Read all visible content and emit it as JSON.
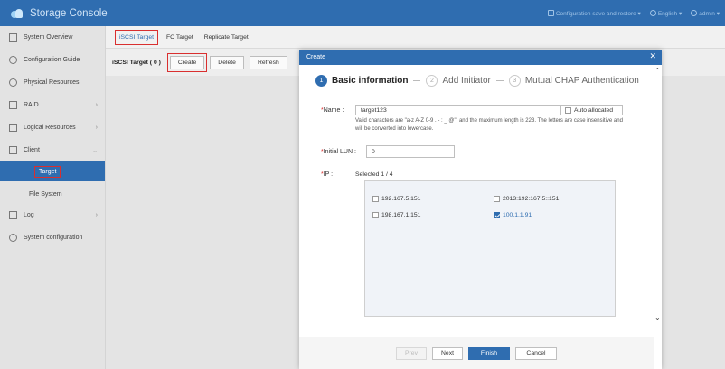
{
  "app": {
    "title": "Storage Console"
  },
  "topbar": {
    "config": "Configuration save and restore ▾",
    "language": "English ▾",
    "user": "admin ▾"
  },
  "sidebar": {
    "items": [
      {
        "label": "System Overview",
        "icon": "grid-icon"
      },
      {
        "label": "Configuration Guide",
        "icon": "guide-icon"
      },
      {
        "label": "Physical Resources",
        "icon": "disk-icon"
      },
      {
        "label": "RAID",
        "icon": "raid-icon"
      },
      {
        "label": "Logical Resources",
        "icon": "layers-icon"
      },
      {
        "label": "Client",
        "icon": "client-icon"
      },
      {
        "label": "Target"
      },
      {
        "label": "File System"
      },
      {
        "label": "Log",
        "icon": "log-icon"
      },
      {
        "label": "System configuration",
        "icon": "gear-icon"
      }
    ]
  },
  "tabs": [
    "iSCSI Target",
    "FC Target",
    "Replicate Target"
  ],
  "toolbar": {
    "count": "iSCSI Target ( 0 )",
    "create": "Create",
    "delete": "Delete",
    "refresh": "Refresh"
  },
  "modal": {
    "title": "Create",
    "steps": [
      {
        "num": "1",
        "label": "Basic information"
      },
      {
        "num": "2",
        "label": "Add Initiator"
      },
      {
        "num": "3",
        "label": "Mutual CHAP Authentication"
      }
    ],
    "name_label": "Name :",
    "name_value": "target123",
    "auto_label": "Auto allocated",
    "hint": "Valid characters are \"a-z A-Z 0-9 . - : _ @\", and the maximum length is 223. The letters are case insensitive and will be converted into lowercase.",
    "lun_label": "Initial LUN :",
    "lun_value": "0",
    "ip_label": "IP :",
    "selected": "Selected 1 / 4",
    "ips": [
      {
        "addr": "192.167.5.151",
        "checked": false
      },
      {
        "addr": "2013:192:167:5::151",
        "checked": false
      },
      {
        "addr": "198.167.1.151",
        "checked": false
      },
      {
        "addr": "100.1.1.91",
        "checked": true
      }
    ],
    "buttons": {
      "prev": "Prev",
      "next": "Next",
      "finish": "Finish",
      "cancel": "Cancel"
    }
  }
}
